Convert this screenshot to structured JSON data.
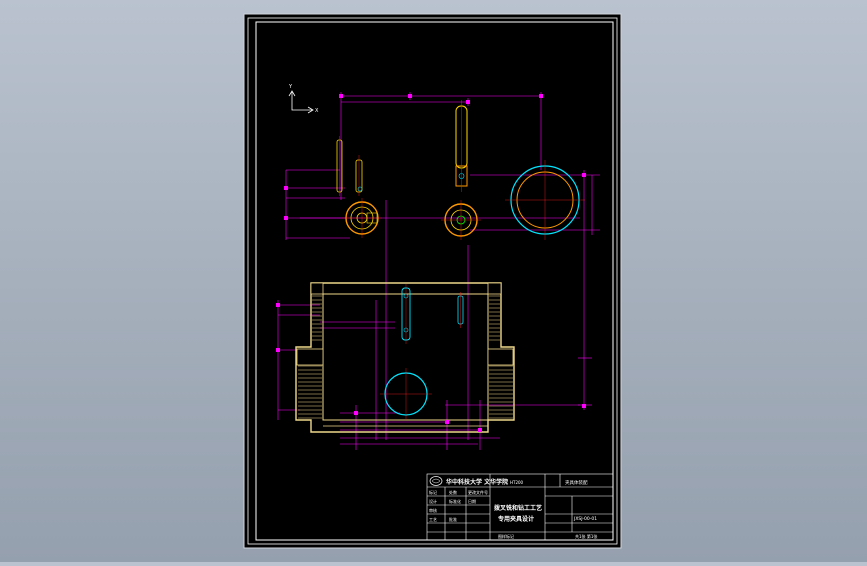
{
  "colors": {
    "background_top": "#b9c2ce",
    "background_bottom": "#95a0ae",
    "sheet": "#000000",
    "frame": "#ffffff",
    "dimension": "#ff00ff",
    "part_yellow": "#ffd700",
    "part_orange": "#ff9a00",
    "part_cyan": "#00e5ff",
    "center_red": "#ff2020",
    "part_green": "#00ff00",
    "fixture_body": "#f0d98a"
  },
  "axis": {
    "y_label": "Y",
    "x_label": "X"
  },
  "title_block": {
    "school": "华中科技大学 文华学院",
    "scale": "图样标记",
    "drawing_title_line1": "拨叉铣和钻工工艺",
    "drawing_title_line2": "专用夹具设计",
    "sheet_label_top": "夹具体装配",
    "material": "HT200",
    "rows": [
      {
        "label": "标记",
        "col2": "处数",
        "col3": "更改文件号"
      },
      {
        "label": "设计",
        "col2": "标准化",
        "col3": "日期"
      },
      {
        "label": "审核",
        "col2": "",
        "col3": ""
      },
      {
        "label": "工艺",
        "col2": "批准",
        "col3": ""
      }
    ],
    "drawing_number": "JXSJ-00-01",
    "sheet_info": "共1张 第1张"
  }
}
